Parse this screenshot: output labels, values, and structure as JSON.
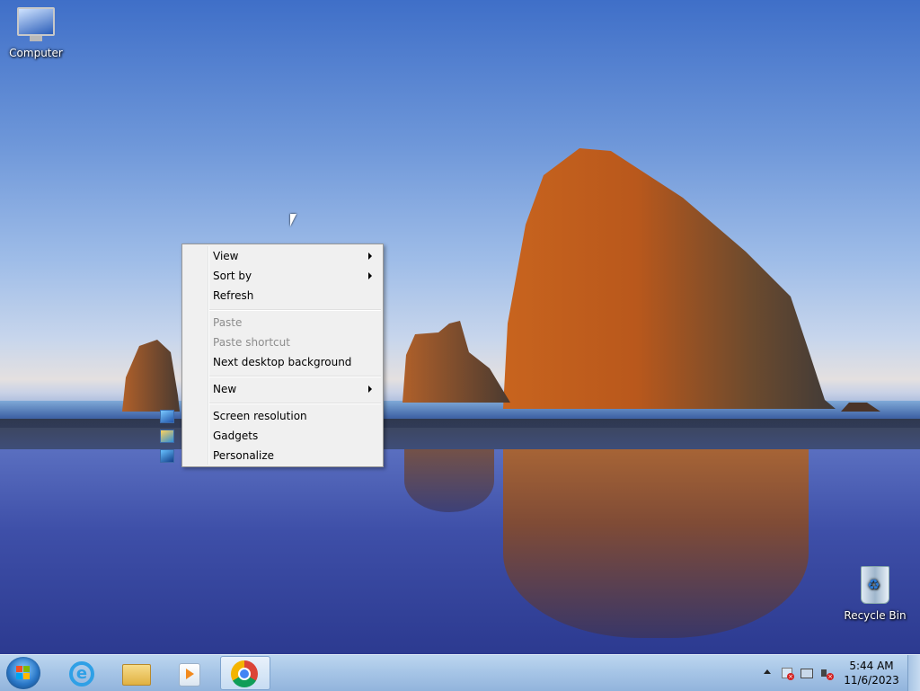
{
  "desktop": {
    "icons": [
      {
        "label": "Computer",
        "icon": "computer-icon"
      },
      {
        "label": "Recycle Bin",
        "icon": "recycle-bin-icon"
      }
    ]
  },
  "context_menu": {
    "items": [
      {
        "label": "View",
        "submenu": true,
        "enabled": true
      },
      {
        "label": "Sort by",
        "submenu": true,
        "enabled": true
      },
      {
        "label": "Refresh",
        "submenu": false,
        "enabled": true
      },
      {
        "label": "Paste",
        "submenu": false,
        "enabled": false
      },
      {
        "label": "Paste shortcut",
        "submenu": false,
        "enabled": false
      },
      {
        "label": "Next desktop background",
        "submenu": false,
        "enabled": true
      },
      {
        "label": "New",
        "submenu": true,
        "enabled": true
      },
      {
        "label": "Screen resolution",
        "submenu": false,
        "enabled": true,
        "icon": "screen-resolution-icon"
      },
      {
        "label": "Gadgets",
        "submenu": false,
        "enabled": true,
        "icon": "gadgets-icon"
      },
      {
        "label": "Personalize",
        "submenu": false,
        "enabled": true,
        "icon": "personalize-icon"
      }
    ]
  },
  "taskbar": {
    "pinned": [
      "internet-explorer-icon",
      "windows-explorer-icon",
      "media-player-icon",
      "chrome-icon"
    ],
    "active": "chrome-icon",
    "clock": {
      "time": "5:44 AM",
      "date": "11/6/2023"
    }
  },
  "colors": {
    "taskbar": "#a5c4e6",
    "menu_bg": "#f0f0f0",
    "menu_disabled_text": "#8d8d8d"
  }
}
